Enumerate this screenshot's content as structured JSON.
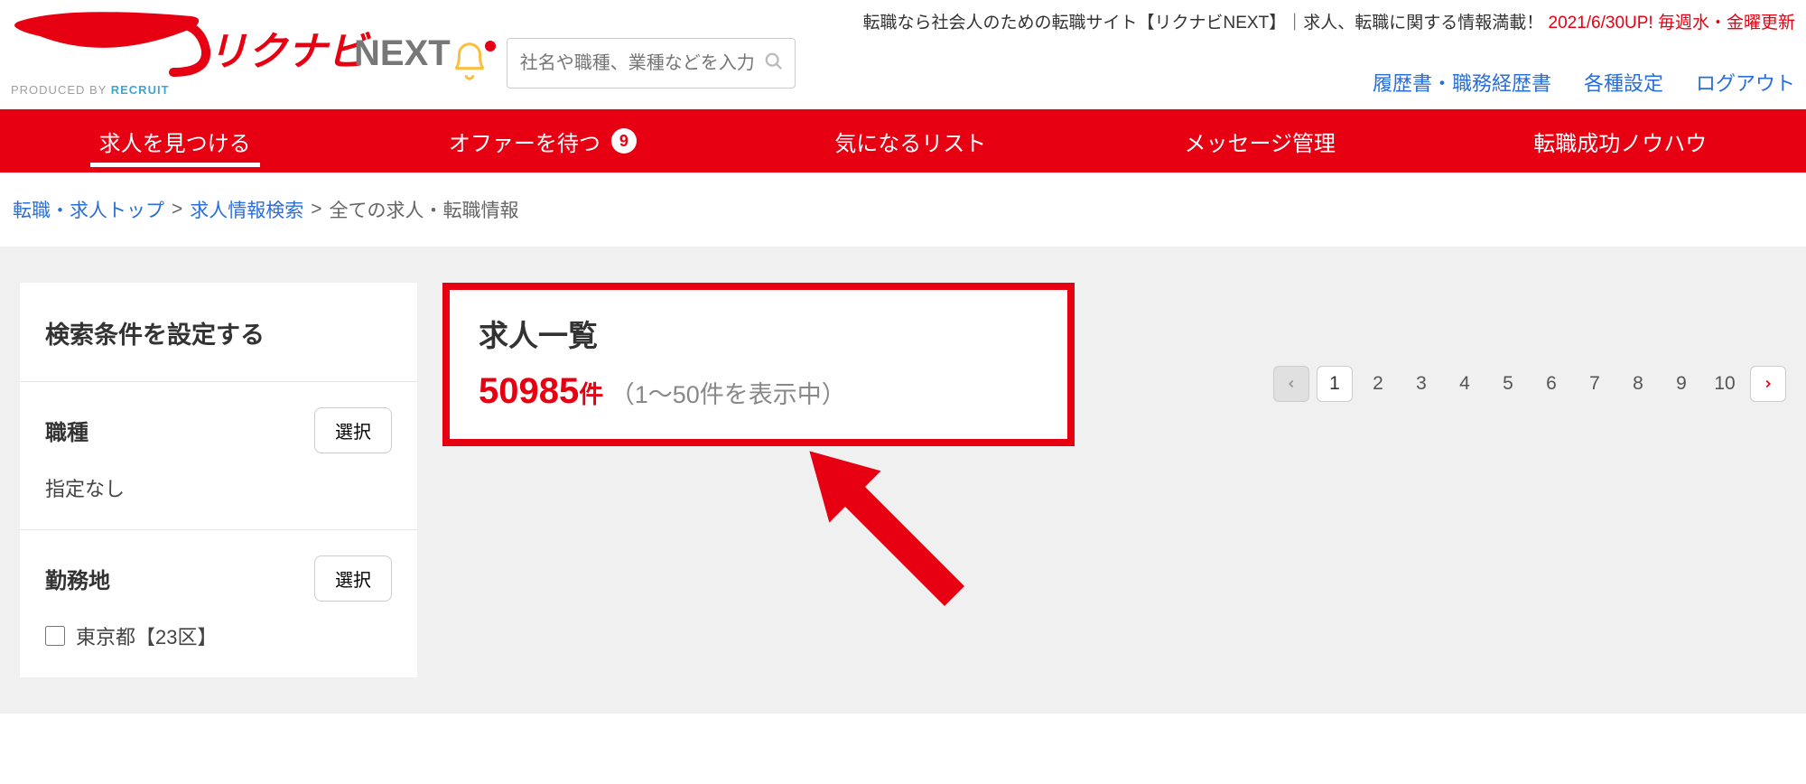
{
  "header": {
    "logo_text_brand": "リクナビ",
    "logo_text_sub": "NEXT",
    "produced_by_prefix": "PRODUCED BY ",
    "produced_by_brand": "RECRUIT",
    "search_placeholder": "社名や職種、業種などを入力",
    "tagline_main": "転職なら社会人のための転職サイト【リクナビNEXT】｜求人、転職に関する情報満載！ ",
    "tagline_highlight": "2021/6/30UP! 毎週水・金曜更新",
    "util_links": [
      "履歴書・職務経歴書",
      "各種設定",
      "ログアウト"
    ]
  },
  "nav": {
    "items": [
      {
        "label": "求人を見つける",
        "active": true
      },
      {
        "label": "オファーを待つ",
        "badge": "9"
      },
      {
        "label": "気になるリスト"
      },
      {
        "label": "メッセージ管理"
      },
      {
        "label": "転職成功ノウハウ"
      }
    ]
  },
  "breadcrumbs": {
    "items": [
      "転職・求人トップ",
      "求人情報検索"
    ],
    "sep": " > ",
    "current": "全ての求人・転職情報"
  },
  "sidebar": {
    "title": "検索条件を設定する",
    "select_btn": "選択",
    "filters": {
      "job": {
        "label": "職種",
        "value": "指定なし"
      },
      "place": {
        "label": "勤務地",
        "checkbox": "東京都【23区】"
      }
    }
  },
  "main": {
    "list_title": "求人一覧",
    "count": "50985",
    "count_unit": "件",
    "range": "（1〜50件を表示中）"
  },
  "pagination": {
    "pages": [
      "1",
      "2",
      "3",
      "4",
      "5",
      "6",
      "7",
      "8",
      "9",
      "10"
    ]
  }
}
